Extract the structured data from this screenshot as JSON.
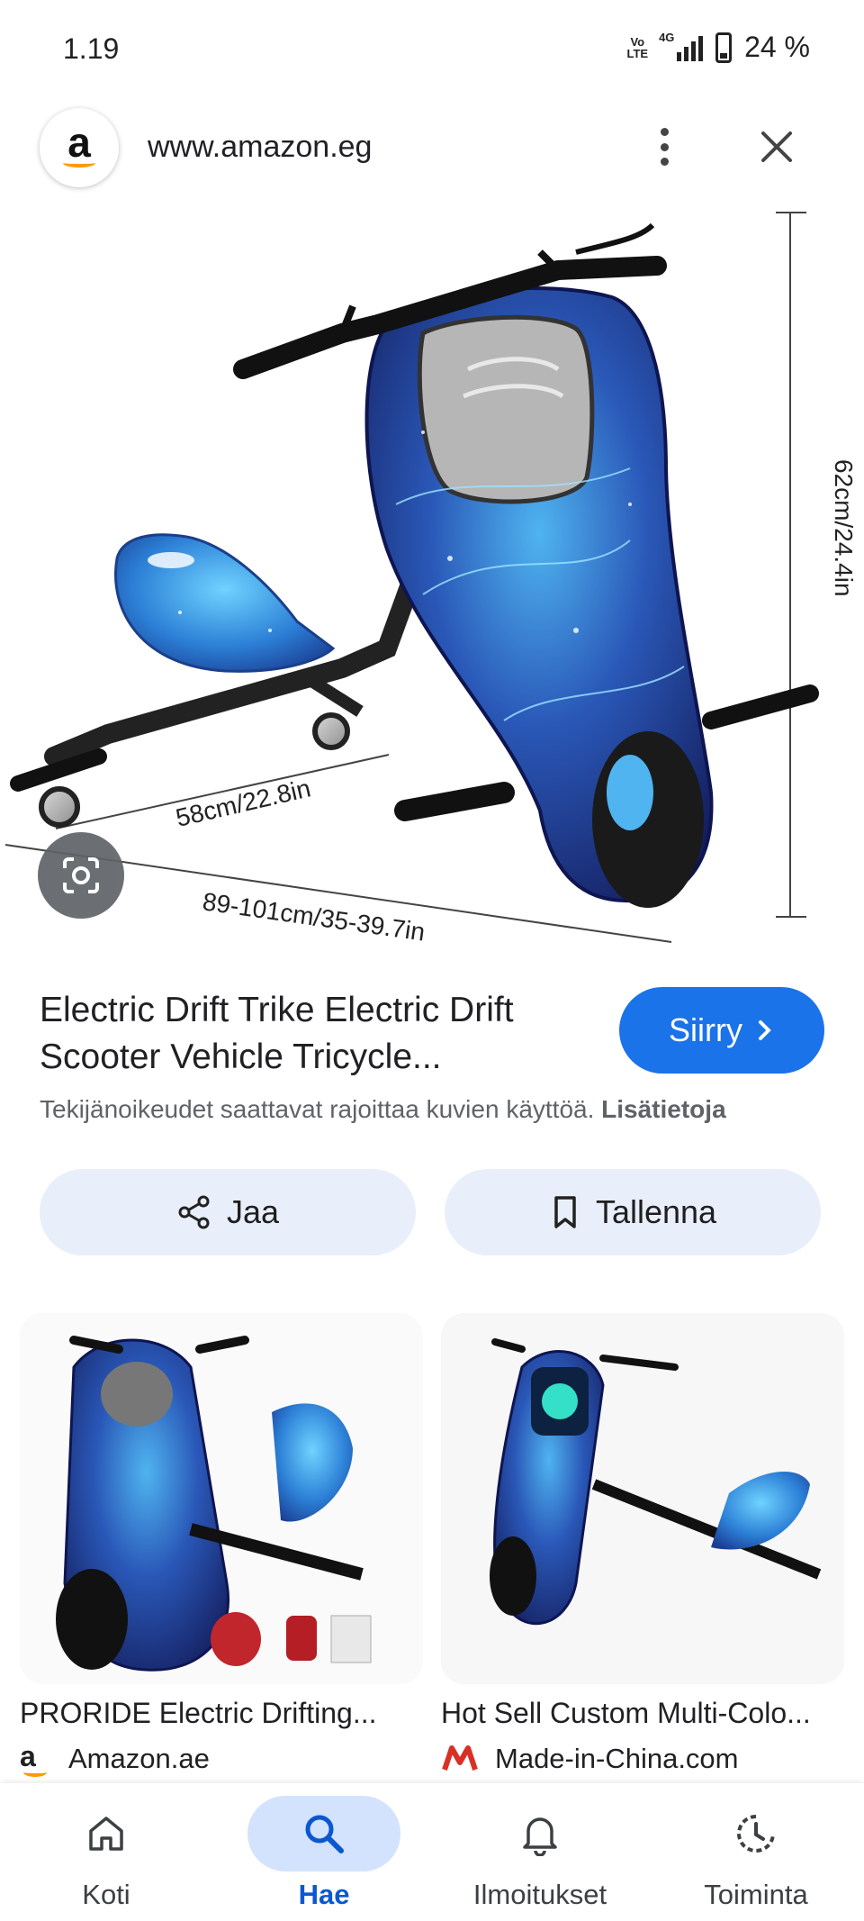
{
  "status_bar": {
    "time": "1.19",
    "volte": "Vo LTE",
    "network": "4G",
    "battery": "24 %"
  },
  "site": {
    "logo_letter": "a",
    "url": "www.amazon.eg"
  },
  "hero": {
    "dims": {
      "height": "62cm/24.4in",
      "seat_width": "58cm/22.8in",
      "length": "89-101cm/35-39.7in"
    }
  },
  "result": {
    "title": "Electric Drift Trike Electric Drift Scooter Vehicle Tricycle...",
    "visit_label": "Siirry",
    "copyright_text": "Tekijänoikeudet saattavat rajoittaa kuvien käyttöä.",
    "learn_more": "Lisätietoja"
  },
  "actions": {
    "share_label": "Jaa",
    "save_label": "Tallenna"
  },
  "related": [
    {
      "title": "PRORIDE Electric Drifting...",
      "source": "Amazon.ae",
      "favicon": "a"
    },
    {
      "title": "Hot Sell Custom Multi-Colo...",
      "source": "Made-in-China.com",
      "favicon": "M"
    }
  ],
  "nav": [
    {
      "label": "Koti",
      "icon": "home-icon",
      "active": false
    },
    {
      "label": "Hae",
      "icon": "search-icon",
      "active": true
    },
    {
      "label": "Ilmoitukset",
      "icon": "bell-icon",
      "active": false
    },
    {
      "label": "Toiminta",
      "icon": "activity-icon",
      "active": false
    }
  ],
  "colors": {
    "accent": "#1a73e8",
    "chip_bg": "#e8effa",
    "nav_active_bg": "#d3e3fd",
    "amazon_orange": "#ff9900",
    "mic_red": "#d93025"
  }
}
